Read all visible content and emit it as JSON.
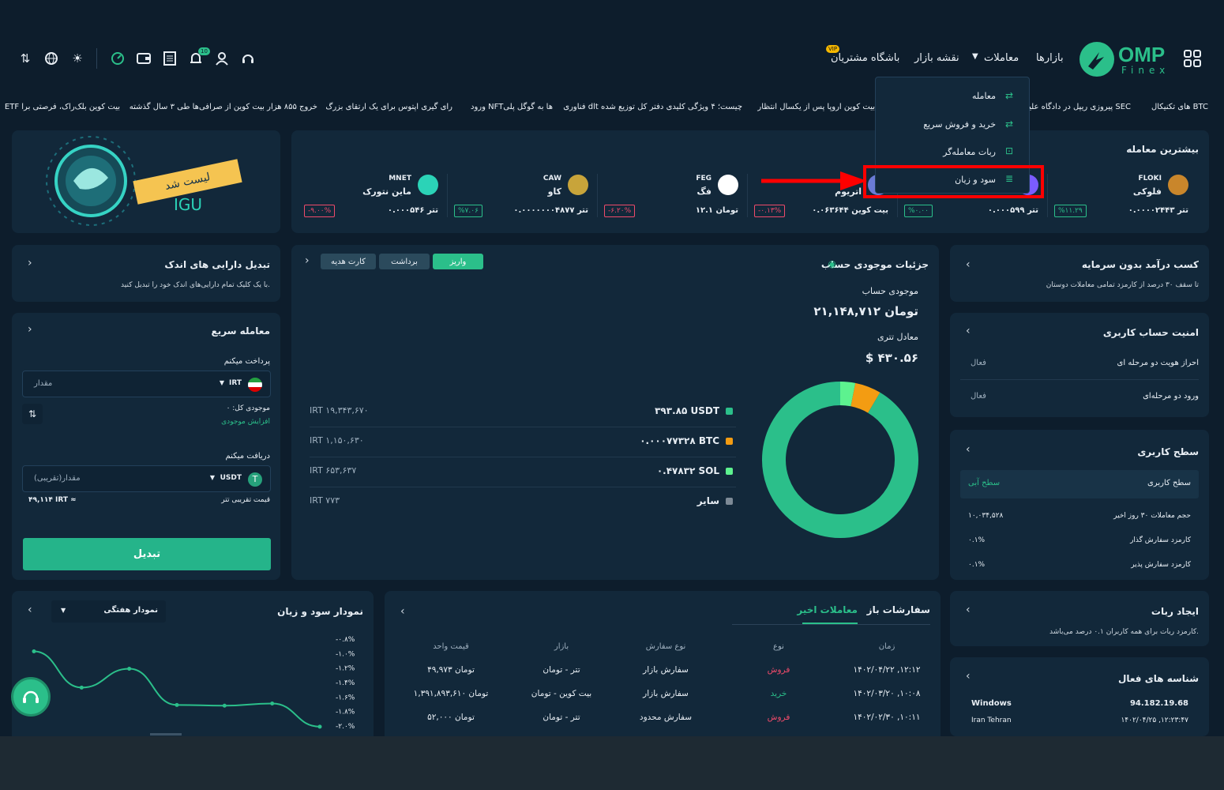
{
  "header": {
    "logo_text": "OMP",
    "logo_sub": "Finex",
    "nav": [
      "بازارها",
      "معاملات",
      "نقشه بازار",
      "باشگاه مشتریان"
    ],
    "vip_badge": "VIP",
    "notification_count": "10"
  },
  "dropdown": {
    "items": [
      "معامله",
      "خرید و فروش سریع",
      "ربات معامله‌گر",
      "سود و زیان"
    ]
  },
  "ticker": [
    "های تکنیکال BTC",
    "پیروزی ریپل در دادگاه علیه SEC",
    "بیت کوین اروپا پس از یکسال انتظار",
    "فناوری dlt چیست؛ ۴ ویژگی کلیدی دفتر کل توزیع شده",
    "ورود NFTها به گوگل پلی",
    "رای گیری اپتوس برای یک ارتقای بزرگ",
    "خروج ۸۵۵ هزار بیت کوین از صرافی‌ها طی ۳ سال گذشته",
    "ETF بیت کوین بلک‌راک، فرصتی برا"
  ],
  "banner": {
    "listed": "لیست شد",
    "coin": "IGU"
  },
  "most_traded": {
    "title": "بیشترین معامله",
    "coins": [
      {
        "symbol": "FLOKI",
        "name": "فلوکی",
        "price": "۰.۰۰۰۰۲۴۴۳ تتر",
        "change": "%۱۱.۲۹",
        "dir": "up"
      },
      {
        "symbol": "",
        "name": "",
        "price": "۰.۰۰۰۵۹۹ تتر",
        "change": "%۰.۰۰",
        "dir": "up"
      },
      {
        "symbol": "",
        "name": "اتریوم",
        "price": "۰.۰۶۳۶۴۴ بیت کوین",
        "change": "-۰.۱۳%",
        "dir": "down"
      },
      {
        "symbol": "FEG",
        "name": "فگ",
        "price": "۱۲.۱ تومان",
        "change": "-۶.۲۰%",
        "dir": "down"
      },
      {
        "symbol": "CAW",
        "name": "کاو",
        "price": "۰.۰۰۰۰۰۰۰۴۸۷۷ تتر",
        "change": "%۷.۰۶",
        "dir": "up"
      },
      {
        "symbol": "MNET",
        "name": "ماین نتورک",
        "price": "۰.۰۰۰۵۴۶ تتر",
        "change": "-۹.۰۰%",
        "dir": "down"
      }
    ]
  },
  "earn": {
    "title": "کسب درآمد بدون سرمایه",
    "desc": "تا سقف ۳۰ درصد از کارمزد تمامی معاملات دوستان"
  },
  "security": {
    "title": "امنیت حساب کاربری",
    "rows": [
      {
        "label": "احراز هویت دو مرحله ای",
        "value": "فعال"
      },
      {
        "label": "ورود دو مرحله‌ای",
        "value": "فعال"
      }
    ]
  },
  "level": {
    "title": "سطح کاربری",
    "level_label": "سطح کاربری",
    "level_value": "سطح آبی",
    "rows": [
      {
        "label": "حجم معاملات ۳۰ روز اخیر",
        "value": "۱۰,۰۳۴,۵۲۸"
      },
      {
        "label": "کارمزد سفارش گذار",
        "value": "۰.۱%"
      },
      {
        "label": "کارمزد سفارش پذیر",
        "value": "۰.۱%"
      }
    ]
  },
  "bot": {
    "title": "ایجاد ربات",
    "desc": "کارمزد ربات برای همه کاربران ۰.۱ درصد می‌باشد."
  },
  "sessions": {
    "title": "شناسه های فعال",
    "ip": "94.182.19.68",
    "os": "Windows",
    "datetime": "۱۴۰۲/۰۴/۲۵ ,۱۲:۲۳:۴۷",
    "location": "Iran Tehran"
  },
  "balance": {
    "title": "جزئیات موجودی حساب",
    "buttons": [
      "واریز",
      "برداشت",
      "کارت هدیه"
    ],
    "balance_label": "موجودی حساب",
    "balance_value": "۲۱,۱۴۸,۷۱۲ تومان",
    "tether_label": "معادل تتری",
    "tether_value": "$ ۴۳۰.۵۶",
    "assets": [
      {
        "amount": "۳۹۳.۸۵ USDT",
        "irt": "IRT ۱۹,۳۴۳,۶۷۰",
        "color": "#2bbf8a",
        "share": 0.915
      },
      {
        "amount": "۰.۰۰۰۷۷۳۲۸ BTC",
        "irt": "IRT ۱,۱۵۰,۶۳۰",
        "color": "#f39c12",
        "share": 0.054
      },
      {
        "amount": "۰.۴۷۸۳۲ SOL",
        "irt": "IRT ۶۵۳,۶۳۷",
        "color": "#5df28f",
        "share": 0.031
      },
      {
        "amount": "سایر",
        "irt": "IRT ۷۷۳",
        "color": "#7d8a96",
        "share": 0.0
      }
    ]
  },
  "convert_small": {
    "title": "تبدیل دارایی های اندک",
    "desc": "با یک کلیک تمام دارایی‌های اندک خود را تبدیل کنید."
  },
  "quick_trade": {
    "title": "معامله سریع",
    "pay_label": "پرداخت میکنم",
    "pay_placeholder": "مقدار",
    "pay_currency": "IRT",
    "total_balance": "موجودی کل: ۰",
    "increase": "افزایش موجودی",
    "receive_label": "دریافت میکنم",
    "receive_placeholder": "مقدار(تقریبی)",
    "receive_currency": "USDT",
    "approx_label": "قیمت تقریبی تتر",
    "approx_value": "۴۹,۱۱۴ IRT ≈",
    "convert_button": "تبدیل"
  },
  "orders": {
    "tabs": [
      "سفارشات باز",
      "معاملات اخیر"
    ],
    "headers": [
      "زمان",
      "نوع",
      "نوع سفارش",
      "بازار",
      "قیمت واحد"
    ],
    "rows": [
      {
        "time": "۱۴۰۲/۰۴/۲۲ ,۱۲:۱۲",
        "type": "فروش",
        "order": "سفارش بازار",
        "market": "تتر - تومان",
        "price": "۴۹,۹۷۳ تومان"
      },
      {
        "time": "۱۴۰۲/۰۳/۲۰ ,۱۰:۰۸",
        "type": "خرید",
        "order": "سفارش بازار",
        "market": "بیت کوین - تومان",
        "price": "۱,۳۹۱,۸۹۳,۶۱۰ تومان"
      },
      {
        "time": "۱۴۰۲/۰۲/۳۰ ,۱۰:۱۱",
        "type": "فروش",
        "order": "سفارش محدود",
        "market": "تتر - تومان",
        "price": "۵۲,۰۰۰ تومان"
      }
    ]
  },
  "pnl": {
    "title": "نمودار سود و زیان",
    "select": "نمودار هفتگی"
  },
  "chart_data": {
    "type": "line",
    "title": "",
    "y_ticks": [
      "-۰.۸%",
      "-۱.۰%",
      "-۱.۲%",
      "-۱.۴%",
      "-۱.۶%",
      "-۱.۸%",
      "-۲.۰%"
    ],
    "ylim": [
      -2.0,
      -0.8
    ],
    "x": [
      1,
      2,
      3,
      4,
      5,
      6,
      7
    ],
    "values": [
      -0.98,
      -1.48,
      -1.22,
      -1.72,
      -1.73,
      -1.7,
      -2.02
    ],
    "color": "#2bbf8a"
  },
  "colors": {
    "accent": "#2bbf8a",
    "down": "#ef4a6a",
    "panel": "#12283a",
    "bg": "#0d1d2c",
    "highlight": "#ff0000"
  }
}
